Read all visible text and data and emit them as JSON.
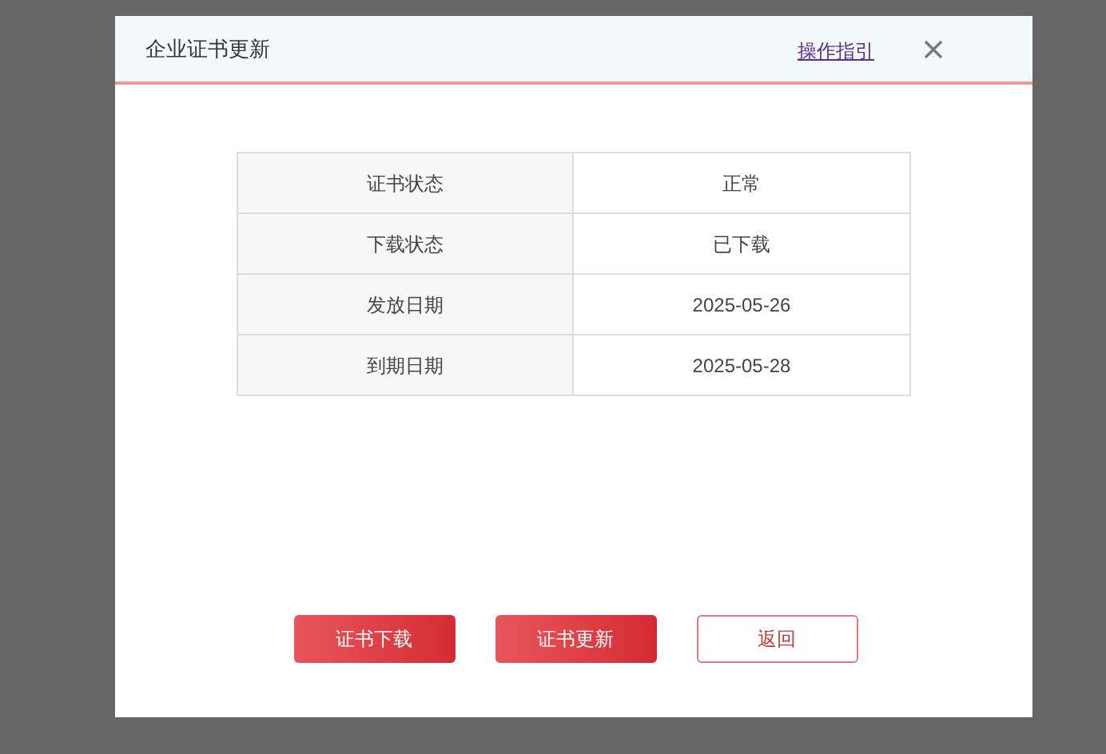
{
  "dialog": {
    "title": "企业证书更新",
    "help_link": "操作指引"
  },
  "table": {
    "rows": [
      {
        "label": "证书状态",
        "value": "正常"
      },
      {
        "label": "下载状态",
        "value": "已下载"
      },
      {
        "label": "发放日期",
        "value": "2025-05-26"
      },
      {
        "label": "到期日期",
        "value": "2025-05-28"
      }
    ]
  },
  "buttons": [
    {
      "label": "证书下载",
      "kind": "primary"
    },
    {
      "label": "证书更新",
      "kind": "primary"
    },
    {
      "label": "返回",
      "kind": "outline"
    }
  ]
}
